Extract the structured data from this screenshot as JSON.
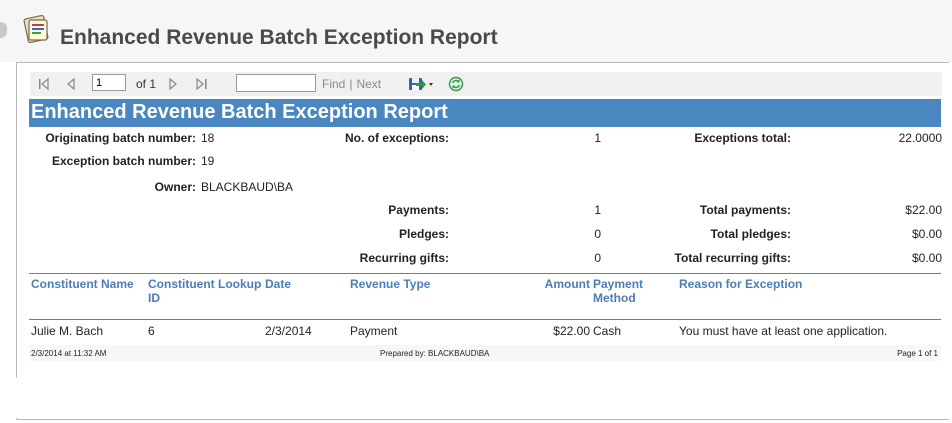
{
  "window": {
    "title": "Enhanced Revenue Batch Exception Report"
  },
  "toolbar": {
    "page_value": "1",
    "page_of": "of 1",
    "find_value": "",
    "find_label": "Find",
    "separator": "|",
    "next_label": "Next"
  },
  "report": {
    "title": "Enhanced Revenue Batch Exception Report",
    "summary": {
      "originating_batch_label": "Originating batch number:",
      "originating_batch_value": "18",
      "exception_batch_label": "Exception batch number:",
      "exception_batch_value": "19",
      "owner_label": "Owner:",
      "owner_value": "BLACKBAUD\\BA",
      "no_exceptions_label": "No. of exceptions:",
      "no_exceptions_value": "1",
      "exceptions_total_label": "Exceptions total:",
      "exceptions_total_value": "22.0000",
      "payments_label": "Payments:",
      "payments_value": "1",
      "pledges_label": "Pledges:",
      "pledges_value": "0",
      "recurring_label": "Recurring gifts:",
      "recurring_value": "0",
      "total_payments_label": "Total payments:",
      "total_payments_value": "$22.00",
      "total_pledges_label": "Total pledges:",
      "total_pledges_value": "$0.00",
      "total_recurring_label": "Total recurring gifts:",
      "total_recurring_value": "$0.00"
    },
    "columns": {
      "constituent_name": "Constituent Name",
      "lookup_id_1": "Constituent Lookup",
      "lookup_id_2": "ID",
      "date": "Date",
      "revenue_type": "Revenue Type",
      "amount": "Amount",
      "payment_method_1": "Payment",
      "payment_method_2": "Method",
      "reason": "Reason for Exception"
    },
    "rows": [
      {
        "constituent_name": "Julie M. Bach",
        "lookup_id": "6",
        "date": "2/3/2014",
        "revenue_type": "Payment",
        "amount": "$22.00",
        "payment_method": "Cash",
        "reason": "You must have at least one application."
      }
    ],
    "footer": {
      "timestamp": "2/3/2014 at 11:32 AM",
      "prepared_by": "Prepared by: BLACKBAUD\\BA",
      "page": "Page 1 of 1"
    }
  },
  "icons": {
    "report": "report-icon",
    "first": "first-page-icon",
    "prev": "previous-page-icon",
    "next": "next-page-icon",
    "last": "last-page-icon",
    "export": "save-export-icon",
    "refresh": "refresh-icon"
  },
  "colors": {
    "banner": "#4a86bf",
    "header_text": "#4a7eb5"
  }
}
